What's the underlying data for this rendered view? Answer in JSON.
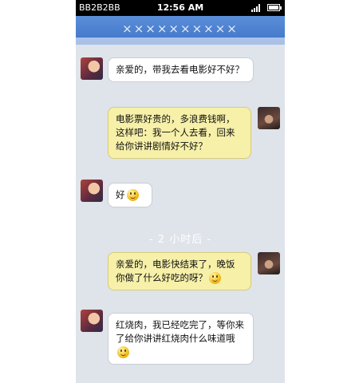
{
  "status_bar": {
    "carrier": "BB2B2BB",
    "time": "12:56 AM"
  },
  "title_bar": {
    "title": "××××××××××"
  },
  "messages": [
    {
      "side": "left",
      "text": "亲爱的，带我去看电影好不好？",
      "emoji": ""
    },
    {
      "side": "right",
      "text": "电影票好贵的，多浪费钱啊，这样吧：我一个人去看，回来给你讲讲剧情好不好？",
      "emoji": ""
    },
    {
      "side": "left",
      "text": "好",
      "emoji": "smile"
    },
    {
      "side": "right",
      "text": "亲爱的，电影快结束了，晚饭你做了什么好吃的呀？",
      "emoji": "smile"
    },
    {
      "side": "left",
      "text": "红烧肉，我已经吃完了，等你来了给你讲讲红烧肉什么味道哦",
      "emoji": "smile"
    }
  ],
  "time_divider": "- 2 小时后 -",
  "icons": [
    "signal-icon",
    "battery-icon",
    "avatar-girl-icon",
    "avatar-boy-icon",
    "smile-emoji-icon"
  ]
}
